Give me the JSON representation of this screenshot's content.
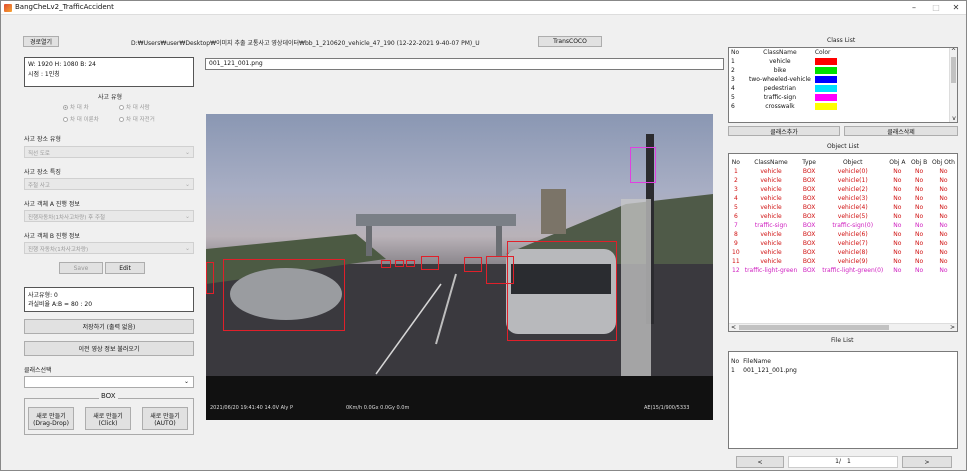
{
  "window": {
    "title": "BangCheLv2_TrafficAccident",
    "minimize": "–",
    "maximize": "□",
    "close": "✕"
  },
  "toolbar": {
    "open_folder": "경로열기",
    "path": "D:₩Users₩user₩Desktop₩이미지 추출 교통사고 영상데이터₩bb_1_210620_vehicle_47_190 (12-22-2021 9-40-07 PM)_U",
    "trans_coco": "TransCOCO"
  },
  "info": {
    "line1": "W: 1920  H: 1080  B: 24",
    "line2": "시점 : 1인칭"
  },
  "filename_field": "001_121_001.png",
  "accident_type": {
    "label": "사고 유형",
    "options": [
      "차 대 차",
      "차 대 사람",
      "차 대 이륜차",
      "차 대 자전거"
    ]
  },
  "place_type": {
    "label": "사고 장소 유형",
    "value": "직선 도로"
  },
  "place_feature": {
    "label": "사고 장소 특징",
    "value": "주철 사고"
  },
  "obj_a": {
    "label": "사고 객체 A 진행 정보",
    "value": "진행자동차(1차사고차량) 후 주철"
  },
  "obj_b": {
    "label": "사고 객체 B 진행 정보",
    "value": "진행 자동차(1차사고차량)"
  },
  "buttons": {
    "save": "Save",
    "edit": "Edit"
  },
  "result": {
    "line1": "사고유형: 0",
    "line2": "과실비율 A:B = 80 : 20"
  },
  "save_all": "저장하기 (출력 없음)",
  "load_prev": "이전 영상 정보 불러오기",
  "class_select": {
    "label": "클래스선택",
    "value": ""
  },
  "box_label": "BOX",
  "new_buttons": [
    {
      "line1": "새로 만들기",
      "line2": "(Drag-Drop)"
    },
    {
      "line1": "새로 만들기",
      "line2": "(Click)"
    },
    {
      "line1": "새로 만들기",
      "line2": "(AUTO)"
    }
  ],
  "video_overlay": {
    "left": "2021/06/20  19:41:40  14.0V  Aly   P",
    "mid": "0Km/h  0.0Gx  0.0Gy  0.0m",
    "right": "AE(15/1/900/5333"
  },
  "class_list": {
    "title": "Class List",
    "headers": [
      "No",
      "ClassName",
      "Color"
    ],
    "rows": [
      {
        "no": "1",
        "name": "vehicle",
        "color": "#ff0000"
      },
      {
        "no": "2",
        "name": "bike",
        "color": "#00e000"
      },
      {
        "no": "3",
        "name": "two-wheeled-vehicle",
        "color": "#0000ff"
      },
      {
        "no": "4",
        "name": "pedestrian",
        "color": "#00e0ff"
      },
      {
        "no": "5",
        "name": "traffic-sign",
        "color": "#ff00ff"
      },
      {
        "no": "6",
        "name": "crosswalk",
        "color": "#ffff00"
      }
    ],
    "add": "클래스추가",
    "delete": "클래스삭제"
  },
  "object_list": {
    "title": "Object List",
    "headers": [
      "No",
      "ClassName",
      "Type",
      "Object",
      "Obj A",
      "Obj B",
      "Obj Oth"
    ],
    "rows": [
      {
        "no": "1",
        "cls": "vehicle",
        "type": "BOX",
        "obj": "vehicle(0)",
        "a": "No",
        "b": "No",
        "o": "No",
        "color": "#d01010"
      },
      {
        "no": "2",
        "cls": "vehicle",
        "type": "BOX",
        "obj": "vehicle(1)",
        "a": "No",
        "b": "No",
        "o": "No",
        "color": "#d01010"
      },
      {
        "no": "3",
        "cls": "vehicle",
        "type": "BOX",
        "obj": "vehicle(2)",
        "a": "No",
        "b": "No",
        "o": "No",
        "color": "#d01010"
      },
      {
        "no": "4",
        "cls": "vehicle",
        "type": "BOX",
        "obj": "vehicle(3)",
        "a": "No",
        "b": "No",
        "o": "No",
        "color": "#d01010"
      },
      {
        "no": "5",
        "cls": "vehicle",
        "type": "BOX",
        "obj": "vehicle(4)",
        "a": "No",
        "b": "No",
        "o": "No",
        "color": "#d01010"
      },
      {
        "no": "6",
        "cls": "vehicle",
        "type": "BOX",
        "obj": "vehicle(5)",
        "a": "No",
        "b": "No",
        "o": "No",
        "color": "#d01010"
      },
      {
        "no": "7",
        "cls": "traffic-sign",
        "type": "BOX",
        "obj": "traffic-sign(0)",
        "a": "No",
        "b": "No",
        "o": "No",
        "color": "#d020c0"
      },
      {
        "no": "8",
        "cls": "vehicle",
        "type": "BOX",
        "obj": "vehicle(6)",
        "a": "No",
        "b": "No",
        "o": "No",
        "color": "#d01010"
      },
      {
        "no": "9",
        "cls": "vehicle",
        "type": "BOX",
        "obj": "vehicle(7)",
        "a": "No",
        "b": "No",
        "o": "No",
        "color": "#d01010"
      },
      {
        "no": "10",
        "cls": "vehicle",
        "type": "BOX",
        "obj": "vehicle(8)",
        "a": "No",
        "b": "No",
        "o": "No",
        "color": "#d01010"
      },
      {
        "no": "11",
        "cls": "vehicle",
        "type": "BOX",
        "obj": "vehicle(9)",
        "a": "No",
        "b": "No",
        "o": "No",
        "color": "#d01010"
      },
      {
        "no": "12",
        "cls": "traffic-light-green",
        "type": "BOX",
        "obj": "traffic-light-green(0)",
        "a": "No",
        "b": "No",
        "o": "No",
        "color": "#d020c0"
      }
    ]
  },
  "file_list": {
    "title": "File List",
    "headers": [
      "No",
      "FileName"
    ],
    "rows": [
      {
        "no": "1",
        "name": "001_121_001.png"
      }
    ]
  },
  "pager": {
    "prev": "<",
    "page": "1/",
    "total": "1",
    "next": ">"
  },
  "scrollbar": {
    "left_arrow": "<",
    "right_arrow": ">",
    "up_arrow": "^",
    "down_arrow": "v"
  }
}
